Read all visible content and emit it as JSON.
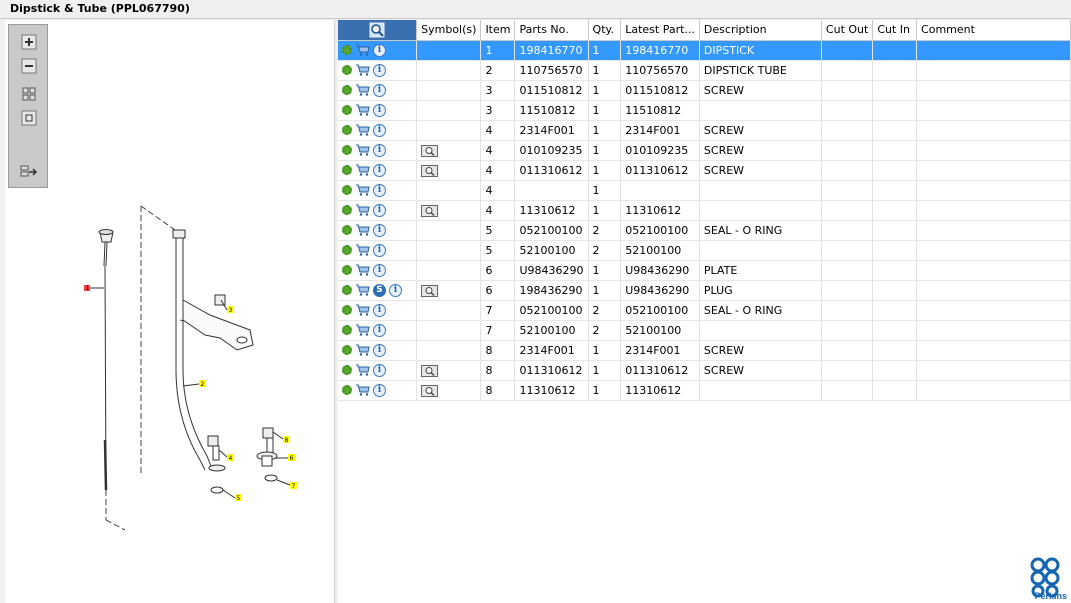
{
  "window": {
    "title": "Dipstick & Tube (PPL067790)"
  },
  "toolbox": {
    "icons": [
      "zoom-in-icon",
      "zoom-out-icon",
      "fit-grid-icon",
      "fit-page-icon",
      "export-icon"
    ]
  },
  "drawing": {
    "callouts": [
      "1",
      "2",
      "3",
      "4",
      "5",
      "6",
      "7",
      "8"
    ]
  },
  "table": {
    "columns": [
      "",
      "Symbol(s)",
      "Item",
      "Parts No.",
      "Qty.",
      "Latest Part...",
      "Description",
      "Cut Out",
      "Cut In",
      "Comment"
    ],
    "rows": [
      {
        "symbol": false,
        "s": false,
        "item": "1",
        "part": "198416770",
        "qty": "1",
        "latest": "198416770",
        "desc": "DIPSTICK",
        "selected": true
      },
      {
        "symbol": false,
        "s": false,
        "item": "2",
        "part": "110756570",
        "qty": "1",
        "latest": "110756570",
        "desc": "DIPSTICK TUBE"
      },
      {
        "symbol": false,
        "s": false,
        "item": "3",
        "part": "011510812",
        "qty": "1",
        "latest": "011510812",
        "desc": "SCREW"
      },
      {
        "symbol": false,
        "s": false,
        "item": "3",
        "part": "11510812",
        "qty": "1",
        "latest": "11510812",
        "desc": ""
      },
      {
        "symbol": false,
        "s": false,
        "item": "4",
        "part": "2314F001",
        "qty": "1",
        "latest": "2314F001",
        "desc": "SCREW"
      },
      {
        "symbol": true,
        "s": false,
        "item": "4",
        "part": "010109235",
        "qty": "1",
        "latest": "010109235",
        "desc": "SCREW"
      },
      {
        "symbol": true,
        "s": false,
        "item": "4",
        "part": "011310612",
        "qty": "1",
        "latest": "011310612",
        "desc": "SCREW"
      },
      {
        "symbol": false,
        "s": false,
        "item": "4",
        "part": "",
        "qty": "1",
        "latest": "",
        "desc": ""
      },
      {
        "symbol": true,
        "s": false,
        "item": "4",
        "part": "11310612",
        "qty": "1",
        "latest": "11310612",
        "desc": ""
      },
      {
        "symbol": false,
        "s": false,
        "item": "5",
        "part": "052100100",
        "qty": "2",
        "latest": "052100100",
        "desc": "SEAL - O RING"
      },
      {
        "symbol": false,
        "s": false,
        "item": "5",
        "part": "52100100",
        "qty": "2",
        "latest": "52100100",
        "desc": ""
      },
      {
        "symbol": false,
        "s": false,
        "item": "6",
        "part": "U98436290",
        "qty": "1",
        "latest": "U98436290",
        "desc": "PLATE"
      },
      {
        "symbol": true,
        "s": true,
        "item": "6",
        "part": "198436290",
        "qty": "1",
        "latest": "U98436290",
        "desc": "PLUG"
      },
      {
        "symbol": false,
        "s": false,
        "item": "7",
        "part": "052100100",
        "qty": "2",
        "latest": "052100100",
        "desc": "SEAL - O RING"
      },
      {
        "symbol": false,
        "s": false,
        "item": "7",
        "part": "52100100",
        "qty": "2",
        "latest": "52100100",
        "desc": ""
      },
      {
        "symbol": false,
        "s": false,
        "item": "8",
        "part": "2314F001",
        "qty": "1",
        "latest": "2314F001",
        "desc": "SCREW"
      },
      {
        "symbol": true,
        "s": false,
        "item": "8",
        "part": "011310612",
        "qty": "1",
        "latest": "011310612",
        "desc": "SCREW"
      },
      {
        "symbol": true,
        "s": false,
        "item": "8",
        "part": "11310612",
        "qty": "1",
        "latest": "11310612",
        "desc": ""
      }
    ],
    "s_badge": "S",
    "info_glyph": "i"
  },
  "brand": {
    "name": "Perkins",
    "color": "#1466b3"
  },
  "colors": {
    "selection": "#3399ff",
    "header_accent": "#3a6fb0",
    "gear": "#5aa832",
    "info": "#2c66b0"
  }
}
